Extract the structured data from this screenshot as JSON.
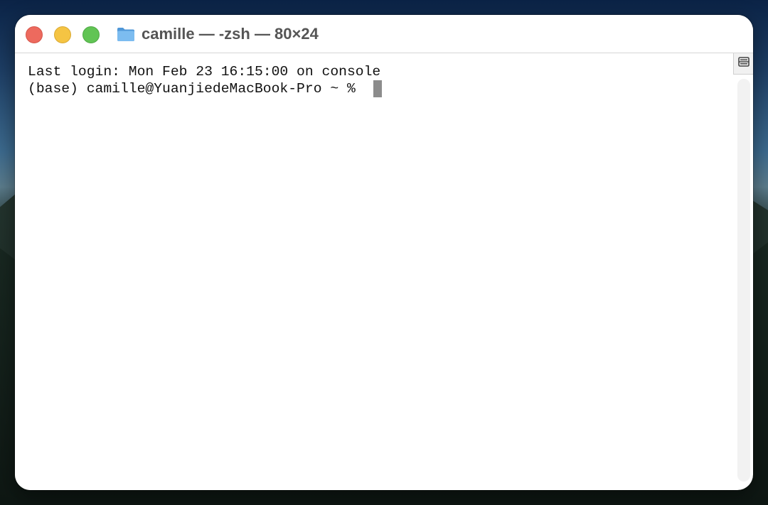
{
  "window": {
    "title": "camille — -zsh — 80×24"
  },
  "terminal": {
    "lines": [
      "Last login: Mon Feb 23 16:15:00 on console",
      "(base) camille@YuanjiedeMacBook-Pro ~ % "
    ]
  },
  "icons": {
    "title_icon": "folder-icon",
    "split": "split-pane-icon"
  },
  "colors": {
    "close": "#ed6a5e",
    "minimize": "#f5c443",
    "zoom": "#61c454",
    "folder": "#62a8e6",
    "cursor": "#8c8c8c"
  }
}
